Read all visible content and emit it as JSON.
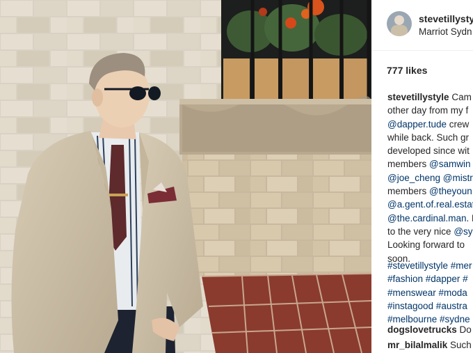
{
  "post": {
    "username": "stevetillysty",
    "location": "Marriot Sydn",
    "likes": "777 likes",
    "caption_lines": [
      {
        "segments": [
          {
            "t": "stevetillystyle",
            "k": "user"
          },
          {
            "t": " Cam",
            "k": "text"
          }
        ]
      },
      {
        "segments": [
          {
            "t": "other day from my f",
            "k": "text"
          }
        ]
      },
      {
        "segments": [
          {
            "t": "@dapper.tude",
            "k": "mention"
          },
          {
            "t": " crew",
            "k": "text"
          }
        ]
      },
      {
        "segments": [
          {
            "t": "while back. Such gr",
            "k": "text"
          }
        ]
      },
      {
        "segments": [
          {
            "t": "developed since wit",
            "k": "text"
          }
        ]
      },
      {
        "segments": [
          {
            "t": "members ",
            "k": "text"
          },
          {
            "t": "@samwin",
            "k": "mention"
          }
        ]
      },
      {
        "segments": [
          {
            "t": "@joe_cheng",
            "k": "mention"
          },
          {
            "t": " ",
            "k": "text"
          },
          {
            "t": "@mistr",
            "k": "mention"
          }
        ]
      },
      {
        "segments": [
          {
            "t": "members ",
            "k": "text"
          },
          {
            "t": "@theyoun",
            "k": "mention"
          }
        ]
      },
      {
        "segments": [
          {
            "t": "@a.gent.of.real.estat",
            "k": "mention"
          }
        ]
      },
      {
        "segments": [
          {
            "t": "@the.cardinal.man",
            "k": "mention"
          },
          {
            "t": ". L",
            "k": "text"
          }
        ]
      },
      {
        "segments": [
          {
            "t": "to the very nice ",
            "k": "text"
          },
          {
            "t": "@sy",
            "k": "mention"
          }
        ]
      },
      {
        "segments": [
          {
            "t": "Looking forward to",
            "k": "text"
          }
        ]
      },
      {
        "segments": [
          {
            "t": "soon.",
            "k": "text"
          }
        ]
      }
    ],
    "hashtag_lines": [
      "#stevetillystyle #mer",
      "#fashion #dapper #",
      "#menswear #moda",
      "#instagood #austra",
      "#melbourne #sydne"
    ],
    "comments": [
      {
        "user": "dogslovetrucks",
        "text": " Do"
      },
      {
        "user": "mr_bilalmalik",
        "text": " Such"
      }
    ]
  },
  "colors": {
    "text": "#262626",
    "link": "#003569",
    "divider": "#efefef",
    "background": "#ffffff"
  }
}
